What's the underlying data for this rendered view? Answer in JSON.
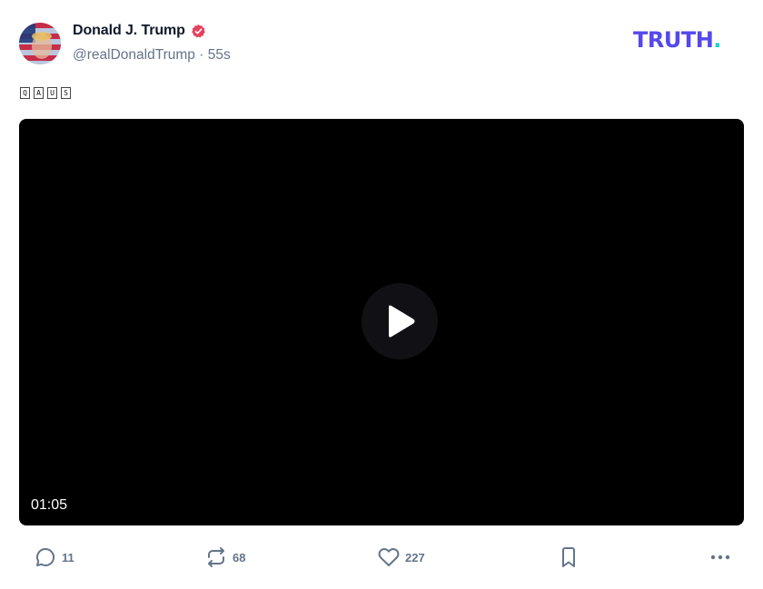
{
  "post": {
    "author_name": "Donald J. Trump",
    "handle": "@realDonaldTrump",
    "separator": "·",
    "time_ago": "55s",
    "verified": true,
    "text_glyphs": [
      "Q",
      "A",
      "U",
      "S"
    ]
  },
  "brand": {
    "logo_text": "TRUTH",
    "logo_dot": ".",
    "primary_color": "#5448ee",
    "accent_color": "#19d3c5"
  },
  "video": {
    "duration": "01:05",
    "play_icon": "play-icon"
  },
  "actions": {
    "reply": {
      "icon": "reply-icon",
      "count": "11"
    },
    "repost": {
      "icon": "repost-icon",
      "count": "68"
    },
    "like": {
      "icon": "heart-icon",
      "count": "227"
    },
    "bookmark": {
      "icon": "bookmark-icon"
    },
    "more": {
      "icon": "more-icon"
    }
  },
  "colors": {
    "verified_badge": "#e5415d",
    "muted_text": "#64748b"
  }
}
